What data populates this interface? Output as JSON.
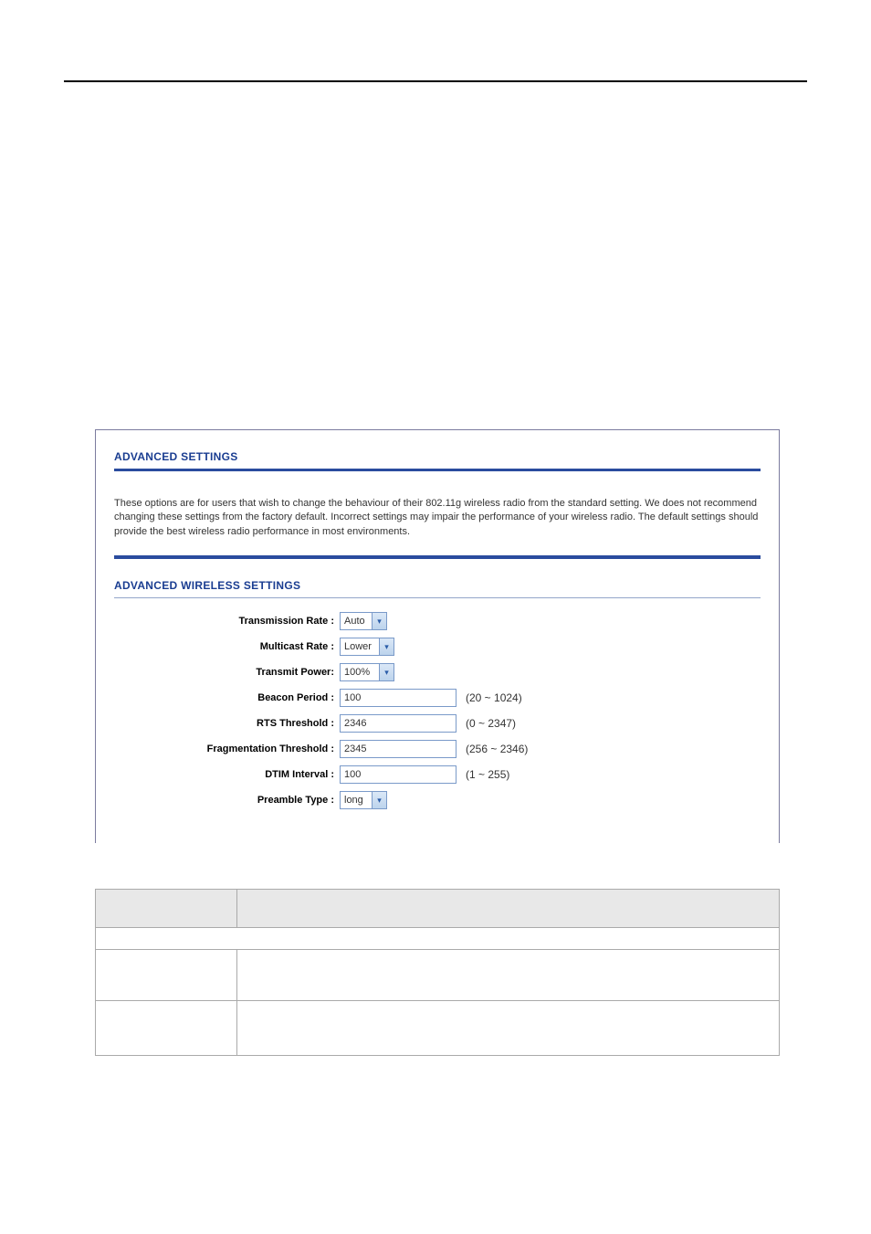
{
  "panel": {
    "title1": "ADVANCED SETTINGS",
    "desc": "These options are for users that wish to change the behaviour of their 802.11g wireless radio from the standard setting. We does not recommend changing these settings from the factory default. Incorrect settings may impair the performance of your wireless radio. The default settings should provide the best wireless radio performance in most environments.",
    "title2": "ADVANCED WIRELESS SETTINGS"
  },
  "fields": {
    "transmission_rate": {
      "label": "Transmission Rate :",
      "value": "Auto"
    },
    "multicast_rate": {
      "label": "Multicast Rate :",
      "value": "Lower"
    },
    "transmit_power": {
      "label": "Transmit Power:",
      "value": "100%"
    },
    "beacon_period": {
      "label": "Beacon Period :",
      "value": "100",
      "hint": "(20 ~ 1024)"
    },
    "rts_threshold": {
      "label": "RTS Threshold :",
      "value": "2346",
      "hint": "(0 ~ 2347)"
    },
    "frag_threshold": {
      "label": "Fragmentation Threshold :",
      "value": "2345",
      "hint": "(256 ~ 2346)"
    },
    "dtim_interval": {
      "label": "DTIM Interval :",
      "value": "100",
      "hint": "(1 ~ 255)"
    },
    "preamble_type": {
      "label": "Preamble Type :",
      "value": "long"
    }
  }
}
